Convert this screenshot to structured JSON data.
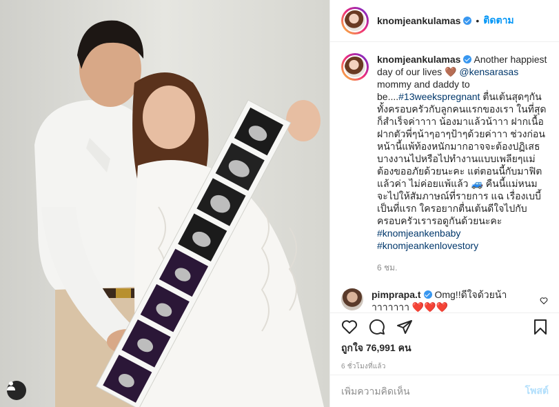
{
  "colors": {
    "accent": "#0095f6",
    "verified": "#3897f0",
    "border": "#efefef",
    "muted": "#8e8e8e",
    "post_disabled": "#b2dffc"
  },
  "photo": {
    "alt": "",
    "tag_icon": "user-tag-icon"
  },
  "header": {
    "username": "knomjeankulamas",
    "separator": "•",
    "follow_label": "ติดตาม",
    "verified_icon": "verified-badge-icon"
  },
  "caption": {
    "username": "knomjeankulamas",
    "text_1": "Another happiest day of our lives",
    "emoji_heart": "🤎",
    "mention": "@kensarasas",
    "text_2": "mommy and daddy to be....",
    "hashtag_1": "#13weekspregnant",
    "text_3": "ตื่นเต้นสุดๆกันทั้งครอบครัวกับลูกคนแรกของเรา ในที่สุดก็สำเร็จค่าาาา น้องมาแล้วน้าาา ฝากเนื้อฝากตัวพี่ๆน้าๆอาๆป้าๆด้วยค่าาา ช่วงก่อนหน้านี้แพ้ท้องหนักมากอาจจะต้องปฏิเสธบางงานไปหรือไปทำงานแบบเพลียๆแม่ต้องขออภัยด้วยนะคะ แต่ตอนนี้กับมาฟิตแล้วค่า ไม่ค่อยแพ้แล้ว",
    "emoji_car": "🚙",
    "text_4": "คืนนี้แม่หนมจะไปให้สัมภาษณ์ที่รายการ แฉ เรื่องเบบี้เป็นที่แรก ใครอยากตื่นเต้นดีใจไปกับครอบครัวเรารอดูกันด้วยนะคะ",
    "hashtag_2": "#knomjeankenbaby",
    "hashtag_3": "#knomjeankenlovestory",
    "time": "6 ชม."
  },
  "comment": {
    "username": "pimprapa.t",
    "text": "Omg!!ดีใจด้วยน้าาาาาาาา",
    "hearts": "❤️❤️❤️",
    "like_icon": "heart-outline-icon"
  },
  "actions": {
    "like_icon": "heart-outline-icon",
    "comment_icon": "comment-icon",
    "share_icon": "share-icon",
    "save_icon": "bookmark-icon",
    "likes_prefix": "ถูกใจ",
    "likes_count": "76,991",
    "likes_suffix": "คน",
    "timestamp": "6 ชั่วโมงที่แล้ว"
  },
  "add_comment": {
    "placeholder": "เพิ่มความคิดเห็น",
    "post_label": "โพสต์"
  }
}
